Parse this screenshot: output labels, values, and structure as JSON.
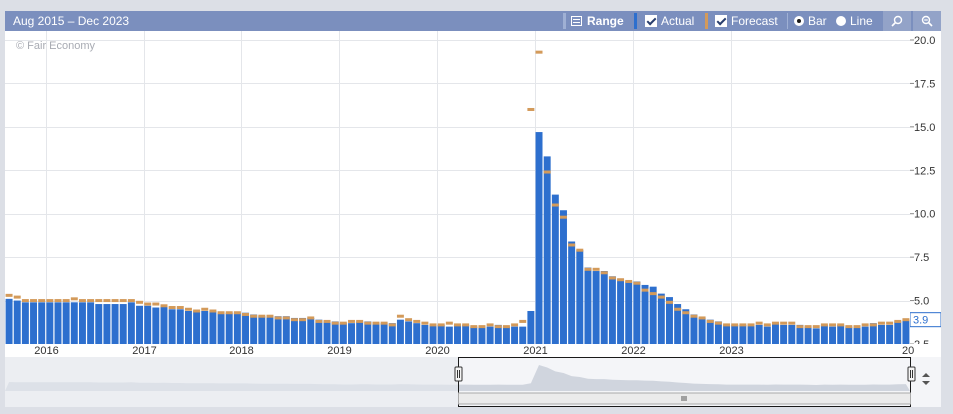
{
  "header": {
    "range_label": "Aug 2015 – Dec 2023",
    "range_button": "Range",
    "actual_label": "Actual",
    "forecast_label": "Forecast",
    "bar_label": "Bar",
    "line_label": "Line",
    "zoom_in_icon": "magnifier-icon",
    "zoom_out_icon": "zoom-out-icon"
  },
  "watermark": "© Fair Economy",
  "last_value_label": "3.9",
  "colors": {
    "actual": "#2d6fce",
    "forecast": "#d39a5a",
    "toolbar": "#7b8fbe",
    "grid": "#e4e6ea"
  },
  "chart_data": {
    "type": "bar",
    "title": "",
    "xlabel": "",
    "ylabel": "",
    "ylim": [
      2.5,
      20.0
    ],
    "yticks": [
      "2.5",
      "5.0",
      "7.5",
      "10.0",
      "12.5",
      "15.0",
      "17.5",
      "20.0"
    ],
    "xticks": [
      "2016",
      "2017",
      "2018",
      "2019",
      "2020",
      "2021",
      "2022",
      "2023",
      "20"
    ],
    "grid": true,
    "x_start": "2015-08",
    "x_end": "2023-12",
    "series": [
      {
        "name": "Actual",
        "values": [
          5.1,
          5.0,
          4.9,
          4.9,
          4.9,
          4.9,
          4.9,
          4.9,
          4.9,
          4.9,
          4.9,
          4.8,
          4.8,
          4.8,
          4.8,
          4.9,
          4.7,
          4.7,
          4.6,
          4.7,
          4.5,
          4.5,
          4.4,
          4.4,
          4.4,
          4.4,
          4.3,
          4.3,
          4.3,
          4.3,
          4.2,
          4.1,
          4.1,
          4.1,
          4.1,
          4.0,
          4.0,
          4.0,
          3.9,
          3.8,
          3.8,
          3.7,
          3.7,
          3.8,
          3.8,
          3.7,
          3.7,
          3.7,
          3.9,
          3.8,
          3.7,
          3.6,
          3.6,
          3.6,
          3.5,
          3.6,
          3.6,
          3.5,
          3.5,
          3.5,
          3.6,
          3.5,
          3.5,
          3.5,
          4.4,
          14.7,
          13.3,
          11.1,
          10.2,
          8.4,
          7.9,
          6.9,
          6.7,
          6.7,
          6.4,
          6.2,
          6.1,
          6.1,
          5.9,
          5.8,
          5.4,
          5.2,
          4.8,
          4.5,
          4.2,
          4.0,
          3.9,
          3.8,
          3.6,
          3.6,
          3.6,
          3.6,
          3.6,
          3.5,
          3.7,
          3.6,
          3.6,
          3.6,
          3.5,
          3.4,
          3.6,
          3.5,
          3.6,
          3.5,
          3.5,
          3.5,
          3.7,
          3.6,
          3.6,
          3.8,
          3.9
        ]
      },
      {
        "name": "Forecast",
        "values": [
          5.3,
          5.2,
          5.0,
          5.0,
          5.0,
          5.0,
          5.0,
          5.0,
          5.1,
          5.0,
          5.0,
          5.0,
          5.0,
          5.0,
          5.0,
          5.0,
          4.9,
          4.8,
          4.8,
          4.7,
          4.6,
          4.6,
          4.5,
          4.4,
          4.5,
          4.4,
          4.3,
          4.3,
          4.3,
          4.2,
          4.1,
          4.1,
          4.1,
          4.0,
          4.0,
          3.9,
          3.9,
          4.0,
          3.8,
          3.8,
          3.7,
          3.7,
          3.8,
          3.8,
          3.7,
          3.7,
          3.7,
          3.6,
          4.1,
          3.9,
          3.8,
          3.7,
          3.6,
          3.6,
          3.7,
          3.6,
          3.6,
          3.5,
          3.5,
          3.6,
          3.5,
          3.5,
          3.6,
          3.8,
          16.0,
          19.3,
          12.4,
          10.5,
          9.8,
          8.2,
          7.9,
          6.8,
          6.8,
          6.6,
          6.3,
          6.2,
          6.1,
          6.0,
          5.6,
          5.4,
          5.2,
          4.9,
          4.5,
          4.3,
          4.1,
          4.0,
          3.8,
          3.7,
          3.6,
          3.6,
          3.6,
          3.6,
          3.7,
          3.6,
          3.7,
          3.7,
          3.7,
          3.5,
          3.5,
          3.5,
          3.6,
          3.6,
          3.6,
          3.5,
          3.5,
          3.6,
          3.6,
          3.7,
          3.7,
          3.8,
          3.9
        ]
      }
    ]
  }
}
